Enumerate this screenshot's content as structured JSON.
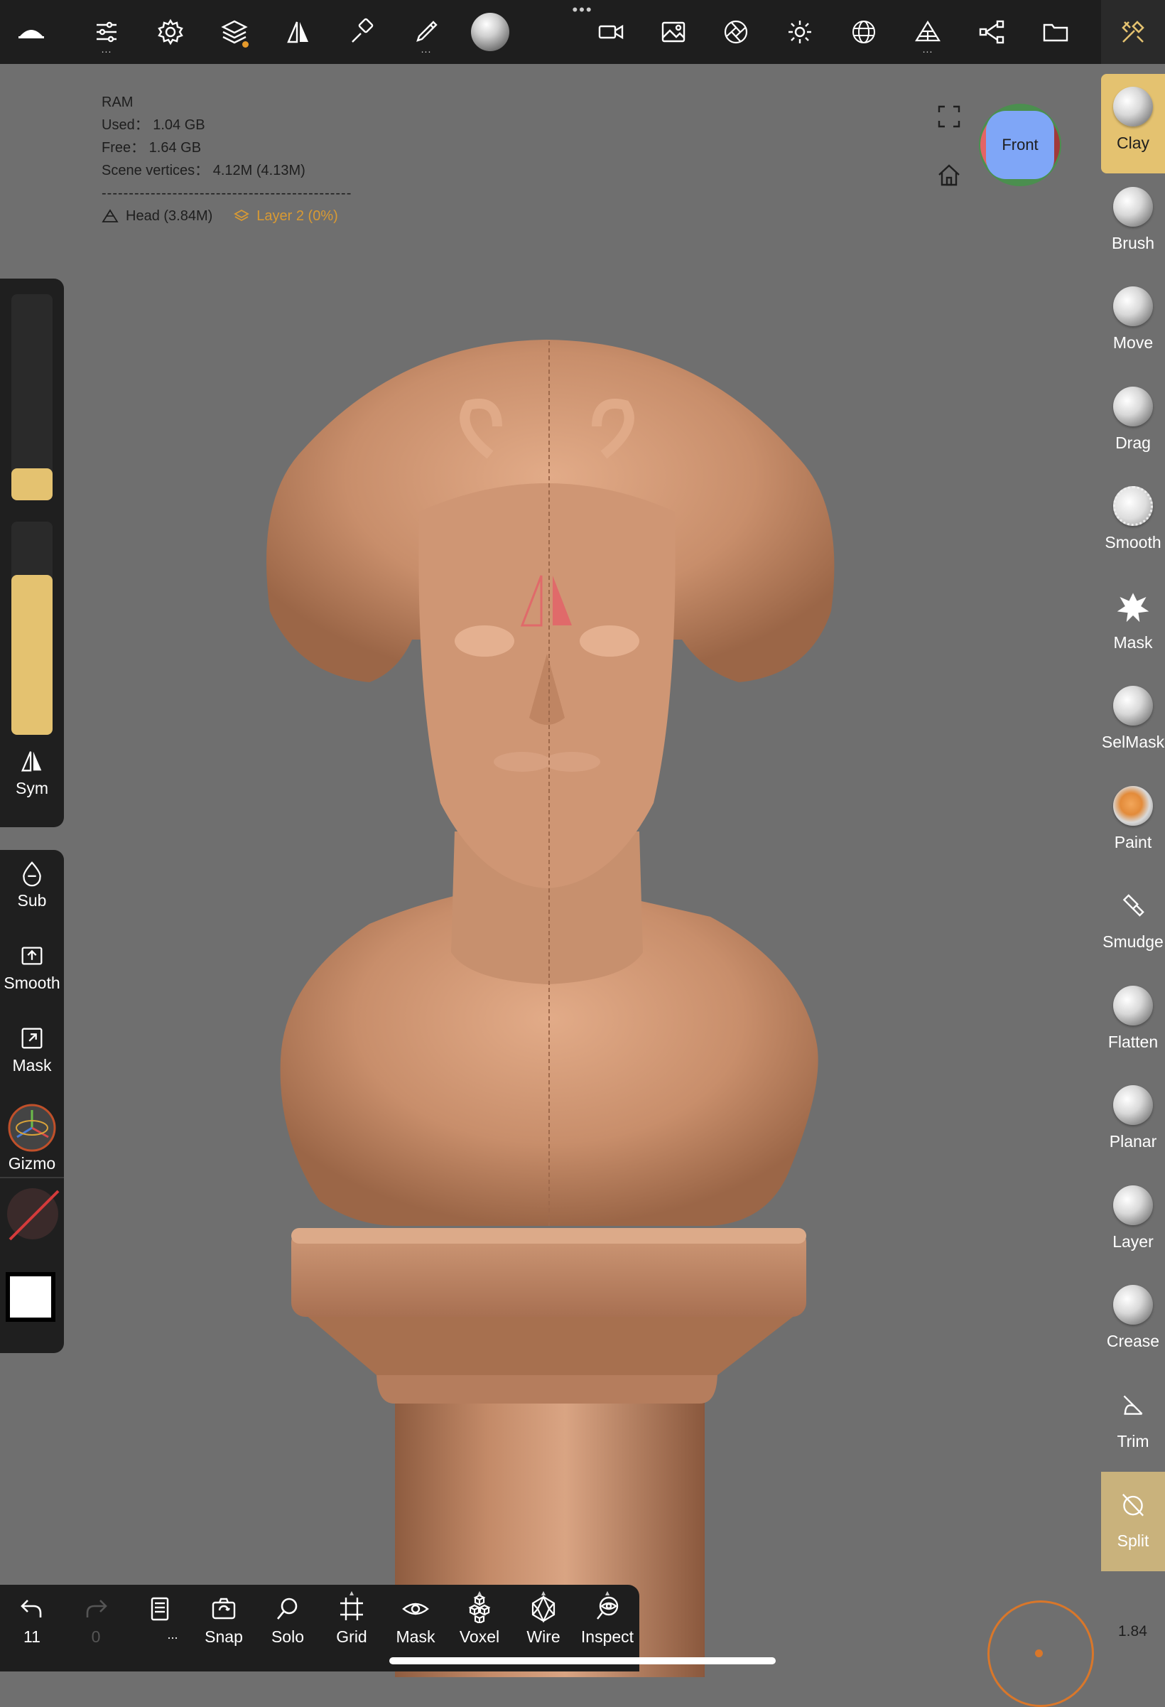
{
  "info": {
    "ram_label": "RAM",
    "used": "Used： 1.04 GB",
    "free": "Free： 1.64 GB",
    "scene_vertices": "Scene vertices： 4.12M (4.13M)",
    "separator": "----------------------------------------------",
    "object": "Head (3.84M)",
    "layer": "Layer 2 (0%)"
  },
  "navcube": {
    "face": "Front"
  },
  "left_panel": {
    "sym": "Sym",
    "sub": "Sub",
    "smooth": "Smooth",
    "mask": "Mask",
    "gizmo": "Gizmo",
    "radius_fraction": 0.12,
    "intensity_fraction": 0.75
  },
  "tools": [
    {
      "label": "Clay",
      "active": true
    },
    {
      "label": "Brush"
    },
    {
      "label": "Move"
    },
    {
      "label": "Drag"
    },
    {
      "label": "Smooth"
    },
    {
      "label": "Mask"
    },
    {
      "label": "SelMask"
    },
    {
      "label": "Paint"
    },
    {
      "label": "Smudge"
    },
    {
      "label": "Flatten"
    },
    {
      "label": "Planar"
    },
    {
      "label": "Layer"
    },
    {
      "label": "Crease"
    },
    {
      "label": "Trim"
    },
    {
      "label": "Split"
    }
  ],
  "bottom": {
    "undo_count": "11",
    "redo_count": "0",
    "more": "...",
    "snap": "Snap",
    "solo": "Solo",
    "grid": "Grid",
    "mask": "Mask",
    "voxel": "Voxel",
    "wire": "Wire",
    "inspect": "Inspect"
  },
  "zoom": "1.84",
  "colors": {
    "accent": "#e4c270",
    "clay": "#c08a68",
    "background": "#6f6f6f",
    "toolbar": "#1e1e1e"
  }
}
